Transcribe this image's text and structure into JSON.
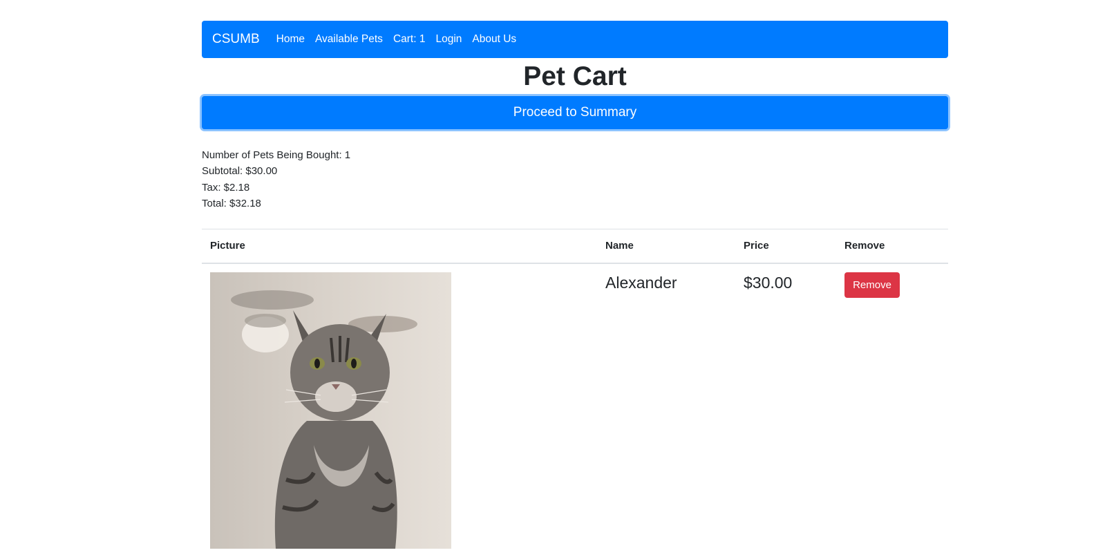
{
  "navbar": {
    "brand": "CSUMB",
    "links": [
      "Home",
      "Available Pets",
      "Cart: 1",
      "Login",
      "About Us"
    ]
  },
  "page_title": "Pet Cart",
  "proceed_button": "Proceed to Summary",
  "summary": {
    "count": "Number of Pets Being Bought: 1",
    "subtotal": "Subtotal: $30.00",
    "tax": "Tax: $2.18",
    "total": "Total: $32.18"
  },
  "table": {
    "headers": [
      "Picture",
      "Name",
      "Price",
      "Remove"
    ],
    "rows": [
      {
        "name": "Alexander",
        "price": "$30.00",
        "remove_label": "Remove"
      }
    ]
  },
  "colors": {
    "primary": "#007bff",
    "danger": "#dc3545"
  }
}
